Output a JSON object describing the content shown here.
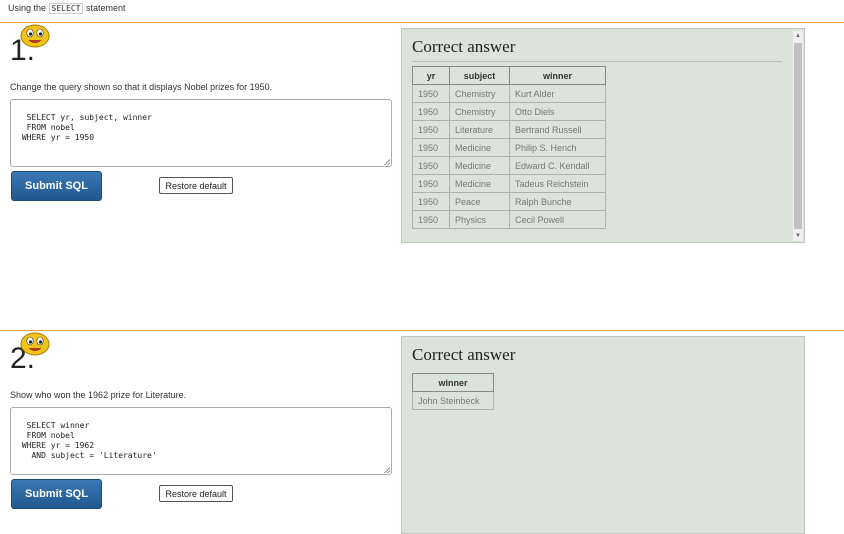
{
  "header": {
    "prefix": "Using the",
    "code": "SELECT",
    "suffix": "statement"
  },
  "q1": {
    "number": "1.",
    "question": "Change the query shown so that it displays Nobel prizes for 1950.",
    "sql": "SELECT yr, subject, winner\n  FROM nobel\n WHERE yr = 1950",
    "submit_label": "Submit SQL",
    "restore_label": "Restore default",
    "answer_title": "Correct answer",
    "columns": [
      "yr",
      "subject",
      "winner"
    ],
    "rows": [
      [
        "1950",
        "Chemistry",
        "Kurt Alder"
      ],
      [
        "1950",
        "Chemistry",
        "Otto Diels"
      ],
      [
        "1950",
        "Literature",
        "Bertrand Russell"
      ],
      [
        "1950",
        "Medicine",
        "Philip S. Hench"
      ],
      [
        "1950",
        "Medicine",
        "Edward C. Kendall"
      ],
      [
        "1950",
        "Medicine",
        "Tadeus Reichstein"
      ],
      [
        "1950",
        "Peace",
        "Ralph Bunche"
      ],
      [
        "1950",
        "Physics",
        "Cecil Powell"
      ]
    ]
  },
  "q2": {
    "number": "2.",
    "question": "Show who won the 1962 prize for Literature.",
    "sql": "SELECT winner\n  FROM nobel\n WHERE yr = 1962\n   AND subject = 'Literature'",
    "submit_label": "Submit SQL",
    "restore_label": "Restore default",
    "answer_title": "Correct answer",
    "columns": [
      "winner"
    ],
    "rows": [
      [
        "John Steinbeck"
      ]
    ]
  }
}
